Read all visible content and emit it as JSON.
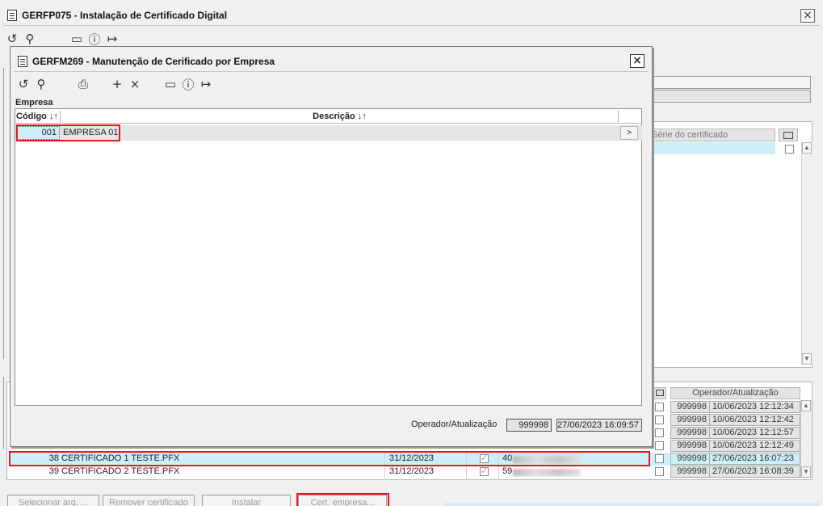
{
  "main_window": {
    "title": "GERFP075 - Instalação de Certificado Digital",
    "close_glyph": "×",
    "toolbar": [
      {
        "name": "undo-icon",
        "glyph": "↺"
      },
      {
        "name": "search-icon",
        "glyph": "⚲"
      },
      {
        "name": "calendar-icon",
        "glyph": "▭"
      },
      {
        "name": "help-icon",
        "glyph": "?"
      },
      {
        "name": "exit-icon",
        "glyph": "↦"
      }
    ],
    "right_grid": {
      "header": "Série do certificado",
      "scroll_up": "▲",
      "scroll_down": "▼"
    },
    "bottom_grid": {
      "operator_header": "Operador/Atualização",
      "ops": [
        {
          "op": "999998",
          "date": "10/06/2023 12:12:34"
        },
        {
          "op": "999998",
          "date": "10/06/2023 12:12:42"
        },
        {
          "op": "999998",
          "date": "10/06/2023 12:12:57"
        },
        {
          "op": "999998",
          "date": "10/06/2023 12:12:49"
        },
        {
          "op": "999998",
          "date": "27/06/2023 16:07:23"
        },
        {
          "op": "999998",
          "date": "27/06/2023 16:08:39"
        }
      ],
      "rows": [
        {
          "id": "38",
          "file": "CERTIFICADO 1 TESTE.PFX",
          "validity": "31/12/2023",
          "serial": "40"
        },
        {
          "id": "39",
          "file": "CERTIFICADO 2 TESTE.PFX",
          "validity": "31/12/2023",
          "serial": "59"
        }
      ]
    },
    "buttons": {
      "select_file": "Selecionar arq. ...",
      "remove_cert": "Remover certificado",
      "install": "Instalar",
      "cert_company": "Cert. empresa..."
    }
  },
  "dialog": {
    "title": "GERFM269 - Manutenção de Cerificado por Empresa",
    "close_glyph": "×",
    "section_label": "Empresa",
    "columns": {
      "code": "Código ↓↑",
      "description": "Descrição ↓↑"
    },
    "rows": [
      {
        "code": "001",
        "description": "EMPRESA 01",
        "action": ">"
      }
    ],
    "operator_label": "Operador/Atualização",
    "operator_value": "999998",
    "updated_value": "27/06/2023 16:09:57"
  },
  "colors": {
    "selection": "#cdeff8",
    "highlight_border": "#e01b1b"
  }
}
